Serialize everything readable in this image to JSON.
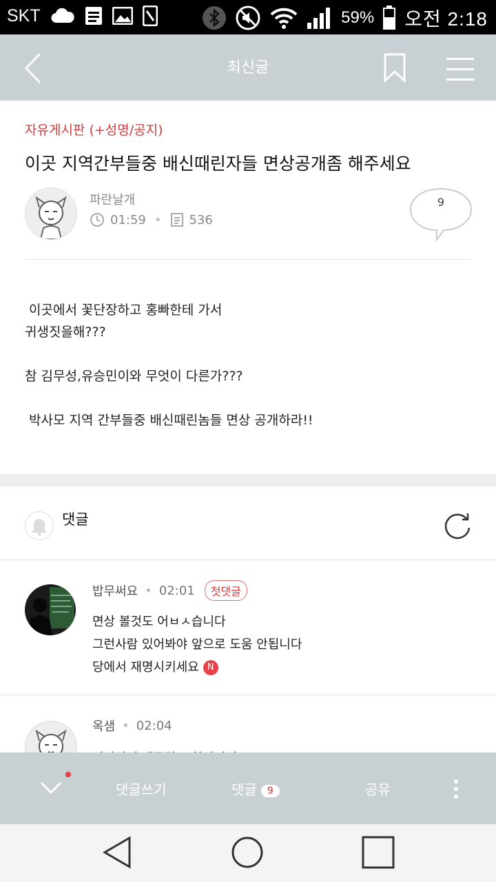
{
  "status_bar": {
    "carrier": "SKT",
    "battery_percent": "59%",
    "time": "오전 2:18",
    "icons": [
      "cloud-icon",
      "document-icon",
      "image-icon",
      "phone-icon",
      "bluetooth-icon",
      "mute-icon",
      "wifi-icon",
      "signal-icon",
      "battery-icon"
    ]
  },
  "app_bar": {
    "title": "최신글",
    "icons": [
      "back-arrow-icon",
      "bookmark-icon",
      "hamburger-menu-icon"
    ]
  },
  "post": {
    "board": "자유게시판 (+성명/공지)",
    "title": "이곳 지역간부들중 배신때린자들 면상공개좀 해주세요",
    "author": "파란날개",
    "time": "01:59",
    "views": "536",
    "comment_count": "9",
    "body_lines": [
      " 이곳에서 꽃단장하고 홍빠한테 가서",
      "귀생짓을해???",
      "",
      "참 김무성,유승민이와 무엇이 다른가???",
      "",
      " 박사모 지역 간부들중 배신때린놈들 면상 공개하라!!"
    ]
  },
  "comments_section": {
    "label": "댓글"
  },
  "comments": [
    {
      "author": "밥무써요",
      "time": "02:01",
      "badge": "첫댓글",
      "lines": [
        "면상 볼것도 어ㅂㅅ습니다",
        "그런사람 있어봐야 앞으로 도움 안됩니다",
        "당에서 재명시키세요"
      ],
      "new_badge": "N"
    },
    {
      "author": "옥샘",
      "time": "02:04",
      "lines": [
        "인자와서 대구말로 한마디멍교?"
      ]
    }
  ],
  "bottom_bar": {
    "write_comment": "댓글쓰기",
    "comments_label": "댓글",
    "comments_count": "9",
    "share": "공유"
  },
  "colors": {
    "app_bar_bg": "#c8d0d4",
    "accent_red": "#d23b3b"
  }
}
